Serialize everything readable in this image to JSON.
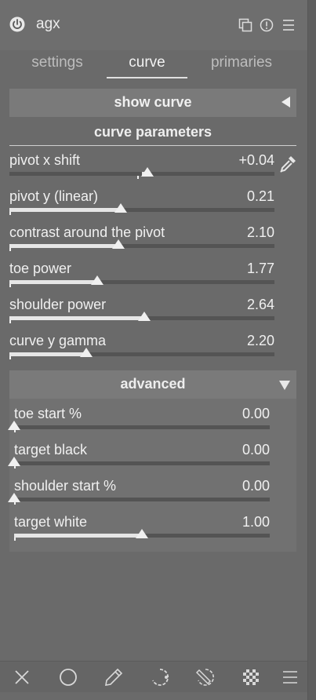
{
  "header": {
    "title": "agx",
    "icons": [
      "power-icon",
      "instances-icon",
      "reset-icon",
      "presets-menu-icon"
    ]
  },
  "tabs": [
    {
      "label": "settings",
      "active": false
    },
    {
      "label": "curve",
      "active": true
    },
    {
      "label": "primaries",
      "active": false
    }
  ],
  "show_curve": {
    "label": "show curve",
    "icon": "collapse-left-triangle-icon"
  },
  "curve_parameters": {
    "title": "curve parameters",
    "sliders": [
      {
        "label": "pivot x shift",
        "value": "+0.04",
        "fraction": 0.52,
        "bipolar": true
      },
      {
        "label": "pivot y (linear)",
        "value": "0.21",
        "fraction": 0.42
      },
      {
        "label": "contrast around the pivot",
        "value": "2.10",
        "fraction": 0.41
      },
      {
        "label": "toe power",
        "value": "1.77",
        "fraction": 0.33
      },
      {
        "label": "shoulder power",
        "value": "2.64",
        "fraction": 0.51
      },
      {
        "label": "curve y gamma",
        "value": "2.20",
        "fraction": 0.29
      }
    ],
    "picker_icon": "color-picker-icon"
  },
  "advanced": {
    "title": "advanced",
    "icon": "expand-down-triangle-icon",
    "sliders": [
      {
        "label": "toe start %",
        "value": "0.00",
        "fraction": 0.0
      },
      {
        "label": "target black",
        "value": "0.00",
        "fraction": 0.0
      },
      {
        "label": "shoulder start %",
        "value": "0.00",
        "fraction": 0.0
      },
      {
        "label": "target white",
        "value": "1.00",
        "fraction": 0.5
      }
    ]
  },
  "toolbar": {
    "icons": [
      "off-icon",
      "uniformly-icon",
      "drawn-mask-icon",
      "parametric-mask-icon",
      "drawn-parametric-mask-icon",
      "raster-mask-icon",
      "blend-menu-icon"
    ]
  },
  "colors": {
    "panel_bg": "#6a6a6a",
    "text": "#f0f0f0",
    "slider_fill": "#e6e6e6",
    "slider_track": "#545454"
  }
}
